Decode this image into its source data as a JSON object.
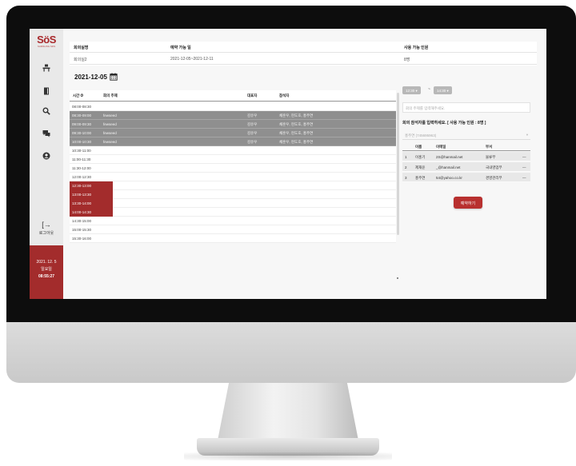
{
  "logo": {
    "text": "SöS",
    "subtitle": "SAMSUNG SDS"
  },
  "nav": {
    "logout_label": "로그아웃",
    "date": "2021. 12. 5",
    "weekday": "일요일",
    "time": "08:55:27"
  },
  "info": {
    "headers": [
      "회의실명",
      "예약 가능 일",
      "사용 가능 인원"
    ],
    "values": [
      "회의실2",
      "2021-12-05~2021-12-11",
      "8명"
    ]
  },
  "date_picker": {
    "value": "2021-12-05",
    "icon": "calendar-icon"
  },
  "schedule": {
    "headers": [
      "시간",
      "회의 주제",
      "대표자",
      "참석자"
    ],
    "rows": [
      {
        "time": "08:00-08:30",
        "topic": "",
        "host": "",
        "attendees": "",
        "state": "free"
      },
      {
        "time": "08:30-09:00",
        "topic": "fewseed",
        "host": "김유우",
        "attendees": "채훈우, 현도호, 홍주연",
        "state": "booked"
      },
      {
        "time": "09:00-09:30",
        "topic": "fewseed",
        "host": "김유우",
        "attendees": "채훈우, 현도호, 홍주연",
        "state": "booked"
      },
      {
        "time": "09:30-10:00",
        "topic": "fewseed",
        "host": "김유우",
        "attendees": "채훈우, 현도호, 홍주연",
        "state": "booked"
      },
      {
        "time": "10:00-10:30",
        "topic": "fewseed",
        "host": "김유우",
        "attendees": "채훈우, 현도호, 홍주연",
        "state": "booked"
      },
      {
        "time": "10:30-11:00",
        "topic": "",
        "host": "",
        "attendees": "",
        "state": "free"
      },
      {
        "time": "11:00-11:30",
        "topic": "",
        "host": "",
        "attendees": "",
        "state": "free"
      },
      {
        "time": "11:30-12:00",
        "topic": "",
        "host": "",
        "attendees": "",
        "state": "free"
      },
      {
        "time": "12:00-12:30",
        "topic": "",
        "host": "",
        "attendees": "",
        "state": "free"
      },
      {
        "time": "12:30-13:00",
        "topic": "",
        "host": "",
        "attendees": "",
        "state": "picked"
      },
      {
        "time": "13:00-13:30",
        "topic": "",
        "host": "",
        "attendees": "",
        "state": "picked"
      },
      {
        "time": "13:30-14:00",
        "topic": "",
        "host": "",
        "attendees": "",
        "state": "picked"
      },
      {
        "time": "14:00-14:30",
        "topic": "",
        "host": "",
        "attendees": "",
        "state": "picked"
      },
      {
        "time": "14:30-15:00",
        "topic": "",
        "host": "",
        "attendees": "",
        "state": "free"
      },
      {
        "time": "15:00-15:30",
        "topic": "",
        "host": "",
        "attendees": "",
        "state": "free"
      },
      {
        "time": "15:30-16:00",
        "topic": "",
        "host": "",
        "attendees": "",
        "state": "free"
      }
    ]
  },
  "booking": {
    "start_time": "12:30 ▾",
    "end_time": "14:30 ▾",
    "separator": "~",
    "topic_placeholder": "회의 주제를 입력해주세요.",
    "attendee_label": "회의 참석자를 입력하세요. [ 사용 가능 인원 : 8명 ]",
    "attendee_placeholder": "홍주연 (745695963)",
    "attendee_headers": [
      "이름",
      "이메일",
      "부서"
    ],
    "attendees": [
      {
        "no": "1",
        "name": "이홍기",
        "email": "2S@hanmail.net",
        "dept": "물류부",
        "action": "—"
      },
      {
        "no": "2",
        "name": "제재윤",
        "email": "_@hanmail.net",
        "dept": "국내영업부",
        "action": "—"
      },
      {
        "no": "3",
        "name": "홍주연",
        "email": "54@yahoo.co.kr",
        "dept": "경영관리부",
        "action": "—"
      }
    ],
    "submit_label": "예약하기"
  },
  "colors": {
    "accent": "#a32c2c",
    "booked": "#8f8f8f"
  }
}
